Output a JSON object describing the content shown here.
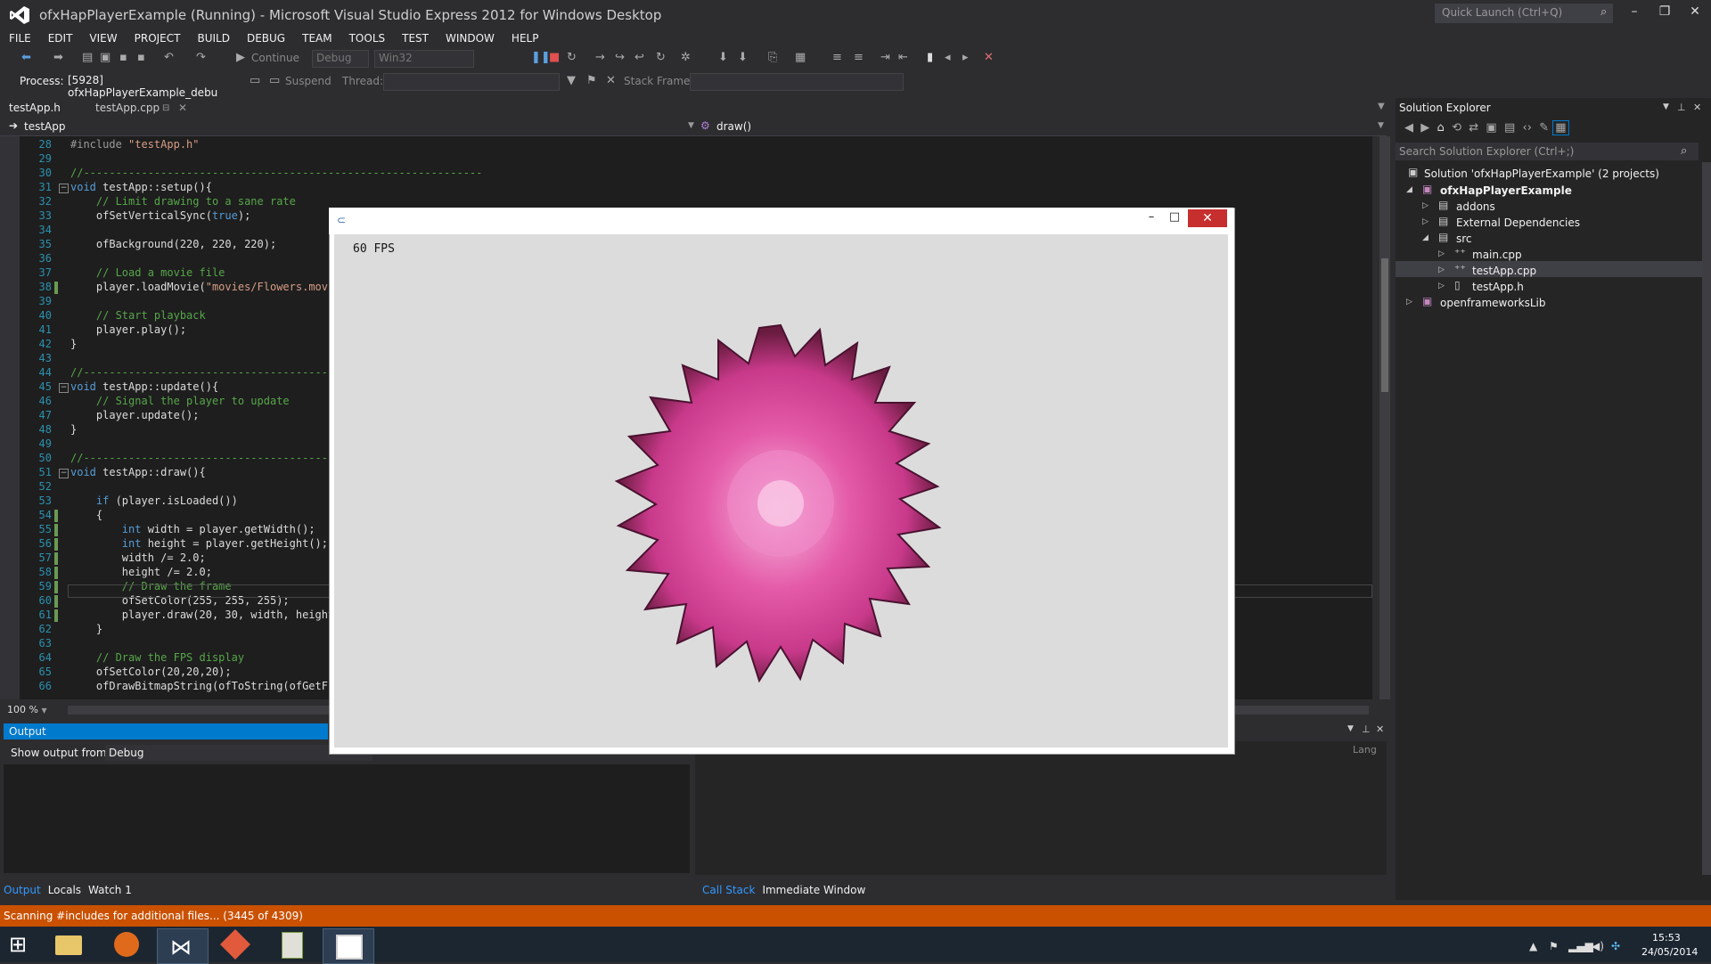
{
  "window": {
    "title": "ofxHapPlayerExample (Running) - Microsoft Visual Studio Express 2012 for Windows Desktop",
    "quick_launch_placeholder": "Quick Launch (Ctrl+Q)"
  },
  "menu": [
    "FILE",
    "EDIT",
    "VIEW",
    "PROJECT",
    "BUILD",
    "DEBUG",
    "TEAM",
    "TOOLS",
    "TEST",
    "WINDOW",
    "HELP"
  ],
  "toolbar": {
    "continue_label": "Continue",
    "config": "Debug",
    "platform": "Win32",
    "process_label": "Process:",
    "process_value": "[5928] ofxHapPlayerExample_debu",
    "suspend_label": "Suspend",
    "thread_label": "Thread:",
    "stack_frame_label": "Stack Frame:"
  },
  "tabs": [
    {
      "label": "testApp.h"
    },
    {
      "label": "testApp.cpp"
    }
  ],
  "nav": {
    "scope": "testApp",
    "member": "draw()"
  },
  "zoom": "100 %",
  "code": [
    {
      "n": "28",
      "t": "#include \"testApp.h\""
    },
    {
      "n": "29",
      "t": ""
    },
    {
      "n": "30",
      "t": "//--------------------------------------------------------------"
    },
    {
      "n": "31",
      "t": "void testApp::setup(){"
    },
    {
      "n": "32",
      "t": "    // Limit drawing to a sane rate"
    },
    {
      "n": "33",
      "t": "    ofSetVerticalSync(true);"
    },
    {
      "n": "34",
      "t": ""
    },
    {
      "n": "35",
      "t": "    ofBackground(220, 220, 220);"
    },
    {
      "n": "36",
      "t": ""
    },
    {
      "n": "37",
      "t": "    // Load a movie file"
    },
    {
      "n": "38",
      "t": "    player.loadMovie(\"movies/Flowers.mov\""
    },
    {
      "n": "39",
      "t": ""
    },
    {
      "n": "40",
      "t": "    // Start playback"
    },
    {
      "n": "41",
      "t": "    player.play();"
    },
    {
      "n": "42",
      "t": "}"
    },
    {
      "n": "43",
      "t": ""
    },
    {
      "n": "44",
      "t": "//-------------------------------------------"
    },
    {
      "n": "45",
      "t": "void testApp::update(){"
    },
    {
      "n": "46",
      "t": "    // Signal the player to update"
    },
    {
      "n": "47",
      "t": "    player.update();"
    },
    {
      "n": "48",
      "t": "}"
    },
    {
      "n": "49",
      "t": ""
    },
    {
      "n": "50",
      "t": "//-------------------------------------------"
    },
    {
      "n": "51",
      "t": "void testApp::draw(){"
    },
    {
      "n": "52",
      "t": ""
    },
    {
      "n": "53",
      "t": "    if (player.isLoaded())"
    },
    {
      "n": "54",
      "t": "    {"
    },
    {
      "n": "55",
      "t": "        int width = player.getWidth();"
    },
    {
      "n": "56",
      "t": "        int height = player.getHeight();"
    },
    {
      "n": "57",
      "t": "        width /= 2.0;"
    },
    {
      "n": "58",
      "t": "        height /= 2.0;"
    },
    {
      "n": "59",
      "t": "        // Draw the frame"
    },
    {
      "n": "60",
      "t": "        ofSetColor(255, 255, 255);"
    },
    {
      "n": "61",
      "t": "        player.draw(20, 30, width, height"
    },
    {
      "n": "62",
      "t": "    }"
    },
    {
      "n": "63",
      "t": ""
    },
    {
      "n": "64",
      "t": "    // Draw the FPS display"
    },
    {
      "n": "65",
      "t": "    ofSetColor(20,20,20);"
    },
    {
      "n": "66",
      "t": "    ofDrawBitmapString(ofToString(ofGetFr"
    }
  ],
  "output": {
    "title": "Output",
    "show_from_label": "Show output from:",
    "show_from_value": "Debug",
    "lang_label": "Lang"
  },
  "bottom_tabs_left": [
    "Output",
    "Locals",
    "Watch 1"
  ],
  "bottom_tabs_right": [
    "Call Stack",
    "Immediate Window"
  ],
  "solution_explorer": {
    "title": "Solution Explorer",
    "search_placeholder": "Search Solution Explorer (Ctrl+;)",
    "items": [
      {
        "label": "Solution 'ofxHapPlayerExample' (2 projects)"
      },
      {
        "label": "ofxHapPlayerExample"
      },
      {
        "label": "addons"
      },
      {
        "label": "External Dependencies"
      },
      {
        "label": "src"
      },
      {
        "label": "main.cpp"
      },
      {
        "label": "testApp.cpp"
      },
      {
        "label": "testApp.h"
      },
      {
        "label": "openframeworksLib"
      }
    ]
  },
  "status": "Scanning #includes for additional files... (3445 of 4309)",
  "app_window": {
    "fps": "60 FPS"
  },
  "clock": {
    "time": "15:53",
    "date": "24/05/2014"
  },
  "colors": {
    "accent": "#007acc",
    "status": "#ca5100",
    "close": "#c72e2e"
  }
}
